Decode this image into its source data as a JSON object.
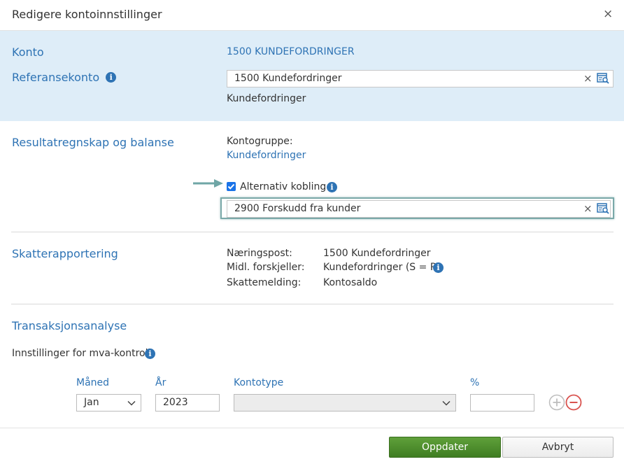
{
  "dialog": {
    "title": "Redigere kontoinnstillinger",
    "close_symbol": "×"
  },
  "account": {
    "konto_label": "Konto",
    "konto_value": "1500 KUNDEFORDRINGER",
    "ref_label": "Referansekonto",
    "ref_input_value": "1500 Kundefordringer",
    "ref_description": "Kundefordringer",
    "clear_symbol": "×"
  },
  "results": {
    "section_label": "Resultatregnskap og balanse",
    "kontogruppe_label": "Kontogruppe:",
    "kontogruppe_value": "Kundefordringer",
    "alt_label": "Alternativ kobling",
    "alt_checked": true,
    "alt_input_value": "2900 Forskudd fra kunder",
    "clear_symbol": "×"
  },
  "tax": {
    "section_label": "Skatterapportering",
    "rows": [
      {
        "label": "Næringspost:",
        "value": "1500 Kundefordringer"
      },
      {
        "label": "Midl. forskjeller:",
        "value": "Kundefordringer (S = R)"
      },
      {
        "label": "Skattemelding:",
        "value": "Kontosaldo"
      }
    ]
  },
  "transactions": {
    "section_label": "Transaksjonsanalyse",
    "mva_label": "Innstillinger for mva-kontroll",
    "headers": {
      "month": "Måned",
      "year": "År",
      "accounttype": "Kontotype",
      "percent": "%"
    },
    "month_value": "Jan",
    "year_value": "2023",
    "accounttype_value": "",
    "percent_value": ""
  },
  "buttons": {
    "update": "Oppdater",
    "cancel": "Avbryt"
  },
  "colors": {
    "accent": "#2e73b4",
    "band": "#deedf8",
    "primary_button": "#4a8a2a",
    "remove_red": "#d9534f"
  },
  "icons": [
    "close-icon",
    "info-icon",
    "clear-icon",
    "lookup-icon",
    "arrow-icon",
    "add-icon",
    "remove-icon",
    "chevron-down-icon"
  ]
}
